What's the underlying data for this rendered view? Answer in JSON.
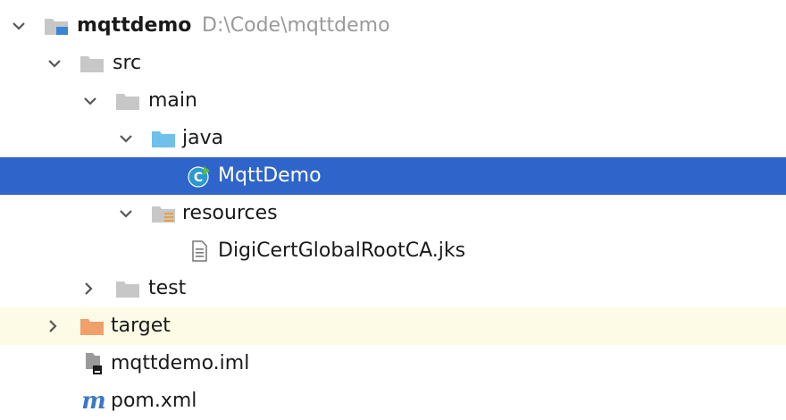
{
  "project_tree": {
    "root": {
      "name": "mqttdemo",
      "path": "D:\\Code\\mqttdemo",
      "icon": "module-folder-icon",
      "expanded": true
    },
    "items": [
      {
        "label": "src",
        "icon": "folder-icon",
        "expanded": true
      },
      {
        "label": "main",
        "icon": "folder-icon",
        "expanded": true
      },
      {
        "label": "java",
        "icon": "source-root-folder-icon",
        "expanded": true
      },
      {
        "label": "MqttDemo",
        "icon": "java-class-icon",
        "selected": true
      },
      {
        "label": "resources",
        "icon": "resources-folder-icon",
        "expanded": true
      },
      {
        "label": "DigiCertGlobalRootCA.jks",
        "icon": "file-icon"
      },
      {
        "label": "test",
        "icon": "folder-icon",
        "expanded": false
      },
      {
        "label": "target",
        "icon": "excluded-folder-icon",
        "expanded": false
      },
      {
        "label": "mqttdemo.iml",
        "icon": "iml-file-icon"
      },
      {
        "label": "pom.xml",
        "icon": "maven-icon",
        "logo_text": "m"
      }
    ]
  },
  "colors": {
    "selection": "#2f65ca",
    "excluded_row": "#fdfbe6",
    "folder": "#c7c7c7",
    "source_folder": "#6fc0ea",
    "excluded_folder": "#f0a06a",
    "maven": "#3a78c9"
  }
}
